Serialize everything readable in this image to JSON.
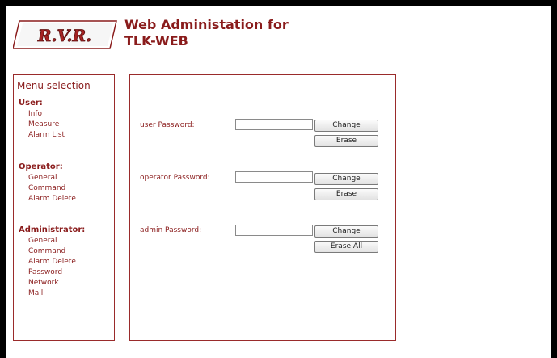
{
  "header": {
    "line1": "Web Administation for",
    "line2": "TLK-WEB",
    "logo_text": "R.V.R."
  },
  "menu": {
    "title": "Menu selection",
    "sections": [
      {
        "title": "User:",
        "items": [
          "Info",
          "Measure",
          "Alarm List"
        ]
      },
      {
        "title": "Operator:",
        "items": [
          "General",
          "Command",
          "Alarm Delete"
        ]
      },
      {
        "title": "Administrator:",
        "items": [
          "General",
          "Command",
          "Alarm Delete",
          "Password",
          "Network",
          "Mail"
        ]
      }
    ]
  },
  "passwords": [
    {
      "label": "user Password:",
      "value": "",
      "change_label": "Change",
      "erase_label": "Erase"
    },
    {
      "label": "operator Password:",
      "value": "",
      "change_label": "Change",
      "erase_label": "Erase"
    },
    {
      "label": "admin Password:",
      "value": "",
      "change_label": "Change",
      "erase_label": "Erase All"
    }
  ],
  "colors": {
    "accent": "#8a1c1c",
    "border": "#9a2b2b"
  }
}
